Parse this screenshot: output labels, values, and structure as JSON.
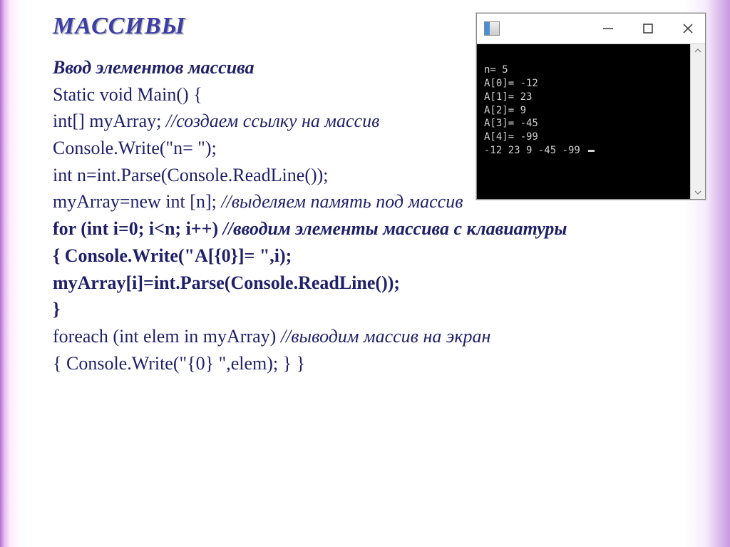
{
  "title": "МАССИВЫ",
  "heading": "Ввод элементов массива",
  "code": {
    "l1": "Static void Main() {",
    "l2a": " int[] myArray;  ",
    "l2b": "//создаем ссылку на массив",
    "l3": "Console.Write(\"n= \");",
    "l4": "int n=int.Parse(Console.ReadLine());",
    "l5a": "myArray=new int [n];  ",
    "l5b": "//выделяем память под массив",
    "l6a": "for (int i=0; i<n; i++)  ",
    "l6b": "//вводим элементы массива с клавиатуры",
    "l7": "{   Console.Write(\"A[{0}]= \",i);",
    "l8": "myArray[i]=int.Parse(Console.ReadLine());",
    "l9": " }",
    "l10a": "foreach (int elem in myArray) ",
    "l10b": "//выводим массив на экран",
    "l11": " {   Console.Write(\"{0} \",elem);  } }"
  },
  "console": {
    "lines": [
      "n= 5",
      "A[0]= -12",
      "A[1]= 23",
      "A[2]= 9",
      "A[3]= -45",
      "A[4]= -99",
      "-12 23 9 -45 -99 "
    ]
  }
}
